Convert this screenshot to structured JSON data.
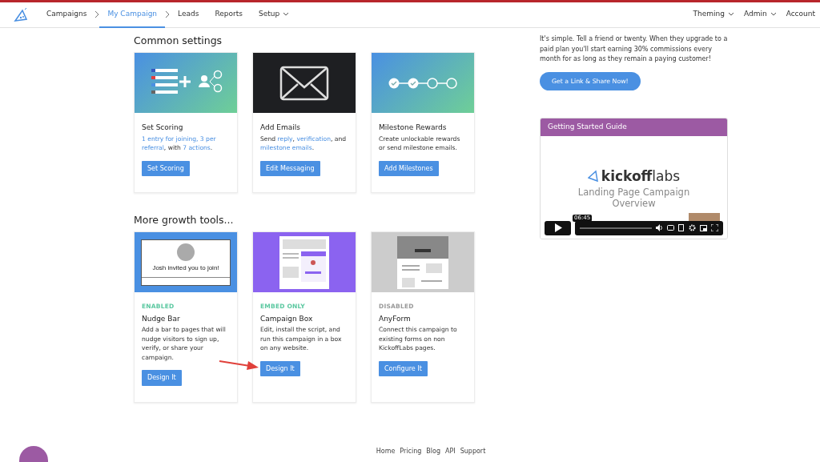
{
  "nav": {
    "left": [
      {
        "label": "Campaigns",
        "selected": false,
        "kind": "link"
      },
      {
        "label": "My Campaign",
        "selected": true,
        "kind": "link"
      },
      {
        "label": "Leads",
        "selected": false,
        "kind": "link"
      },
      {
        "label": "Reports",
        "selected": false,
        "kind": "link"
      },
      {
        "label": "Setup",
        "selected": false,
        "kind": "dropdown"
      }
    ],
    "right": [
      {
        "label": "Theming",
        "kind": "dropdown"
      },
      {
        "label": "Admin",
        "kind": "dropdown"
      },
      {
        "label": "Account",
        "kind": "link"
      }
    ]
  },
  "sections": [
    {
      "title": "Common settings",
      "cards": [
        {
          "kind": "scoring",
          "title": "Set Scoring",
          "description": [
            {
              "text": "1 entry for joining, 3 per",
              "link": true
            },
            {
              "text": "referral",
              "link": true
            },
            {
              "text": ", with ",
              "link": false
            },
            {
              "text": "7 actions",
              "link": true
            },
            {
              "text": ".",
              "link": false
            }
          ],
          "button": "Set Scoring"
        },
        {
          "kind": "email",
          "title": "Add Emails",
          "description": [
            {
              "text": "Send ",
              "link": false
            },
            {
              "text": "reply",
              "link": true
            },
            {
              "text": ", ",
              "link": false
            },
            {
              "text": "verification",
              "link": true
            },
            {
              "text": ", and ",
              "link": false
            },
            {
              "text": "milestone emails",
              "link": true
            },
            {
              "text": ".",
              "link": false
            }
          ],
          "button": "Edit Messaging"
        },
        {
          "kind": "milestones",
          "title": "Milestone Rewards",
          "description": [
            {
              "text": "Create unlockable rewards or send milestone emails.",
              "link": false
            }
          ],
          "button": "Add Milestones"
        }
      ]
    },
    {
      "title": "More growth tools...",
      "cards": [
        {
          "kind": "nudge",
          "image_text": "Josh invited you to join!",
          "status": "ENABLED",
          "color": "#5bc8a0",
          "title": "Nudge Bar",
          "description": [
            {
              "text": "Add a bar to pages that will nudge visitors to sign up, verify, or share your campaign.",
              "link": false
            }
          ],
          "button": "Design It"
        },
        {
          "kind": "box",
          "status": "EMBED ONLY",
          "color": "#5bc8a0",
          "title": "Campaign Box",
          "description": [
            {
              "text": "Edit, install the script, and run this campaign in a box on any website.",
              "link": false
            }
          ],
          "button": "Design It"
        },
        {
          "kind": "anyform",
          "status": "DISABLED",
          "color": "#999999",
          "title": "AnyForm",
          "description": [
            {
              "text": "Connect this campaign to existing forms on non KickoffLabs pages.",
              "link": false
            }
          ],
          "button": "Configure It"
        }
      ]
    }
  ],
  "referral": {
    "text": "It's simple. Tell a friend or twenty. When they upgrade to a paid plan you'll start earning 30% commissions every month for as long as they remain a paying customer!",
    "button": "Get a Link & Share Now!"
  },
  "guide": {
    "title": "Getting Started Guide",
    "video": {
      "logo": "**kickoff**labs",
      "subtitle": "Landing Page Campaign Overview",
      "time": "06:45"
    }
  },
  "footer": [
    "Home",
    "Pricing",
    "Blog",
    "API",
    "Support"
  ]
}
